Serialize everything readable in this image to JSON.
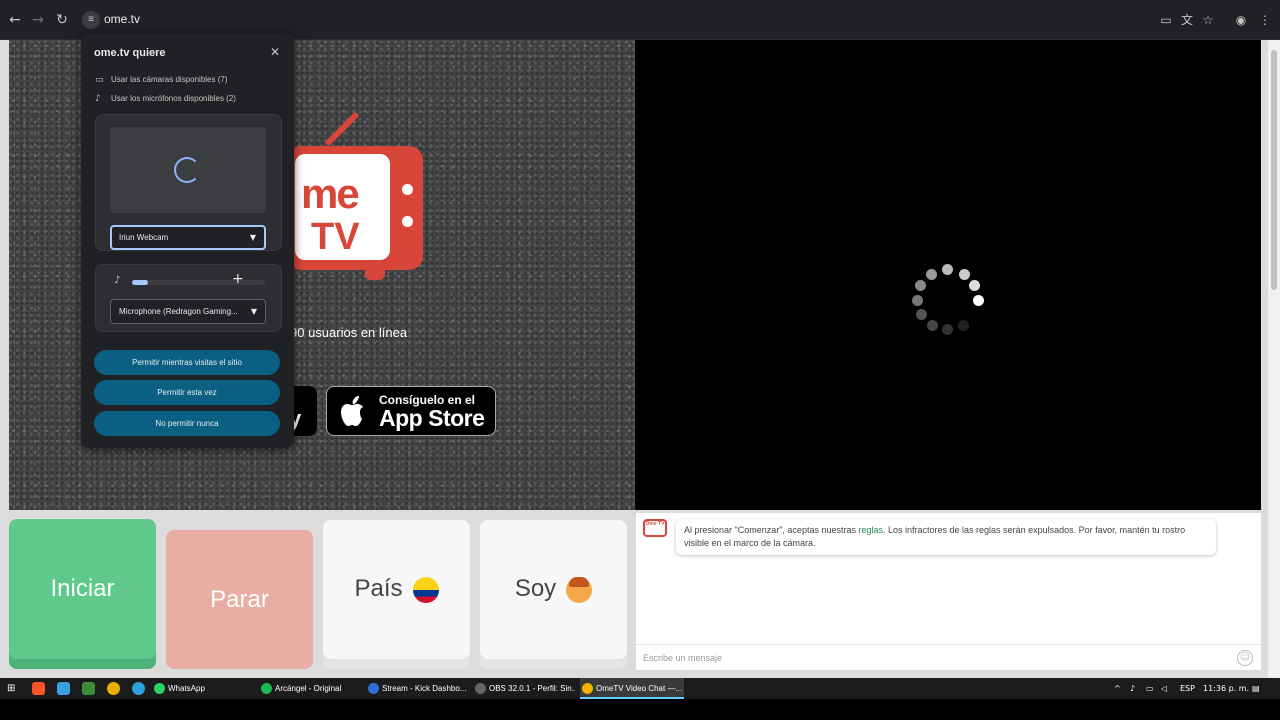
{
  "browser": {
    "url": "ome.tv",
    "colors": {
      "bar": "#202124"
    }
  },
  "popup": {
    "title": "ome.tv quiere",
    "close_icon": "close-icon",
    "permissions": [
      {
        "icon": "camera-icon",
        "label": "Usar las cámaras disponibles (7)"
      },
      {
        "icon": "microphone-icon",
        "label": "Usar los micrófonos disponibles (2)"
      }
    ],
    "camera_select": "Iriun Webcam",
    "mic_select": "Microphone (Redragon Gaming...",
    "mic_level": 0.12,
    "buttons": {
      "allow_always": "Permitir mientras visitas el sitio",
      "allow_once": "Permitir esta vez",
      "deny": "No permitir nunca"
    },
    "button_color": "#0b5f83"
  },
  "left_pane": {
    "logo_line1": "me",
    "logo_line2": "TV",
    "users_online": "90 usuarios en línea",
    "store_left_fragment": "y",
    "appstore_small": "Consíguelo en el",
    "appstore_big": "App Store",
    "logo_color": "#d8463a"
  },
  "controls": {
    "start": "Iniciar",
    "stop": "Parar",
    "country": "País",
    "gender": "Soy",
    "start_color": "#5ec98a",
    "stop_color": "#e8ada3"
  },
  "chat": {
    "logo_text": "Ome TV",
    "message_before": "Al presionar \"Comenzar\", aceptas nuestras ",
    "message_link": "reglas",
    "message_after": ". Los infractores de las reglas serán expulsados. Por favor, mantén tu rostro visible en el marco de la cámara.",
    "input_placeholder": "Escribe un mensaje"
  },
  "taskbar": {
    "items": [
      {
        "label": "WhatsApp",
        "color": "#25d366"
      },
      {
        "label": "Arcángel - Original",
        "color": "#1db954"
      },
      {
        "label": "Stream - Kick Dashbo...",
        "color": "#2f6fd6"
      },
      {
        "label": "OBS 32.0.1 - Perfil: Sin...",
        "color": "#666666"
      },
      {
        "label": "OmeTV Video Chat —...",
        "color": "#f2b400"
      }
    ],
    "language": "ESP",
    "time": "11:36 p. m."
  }
}
